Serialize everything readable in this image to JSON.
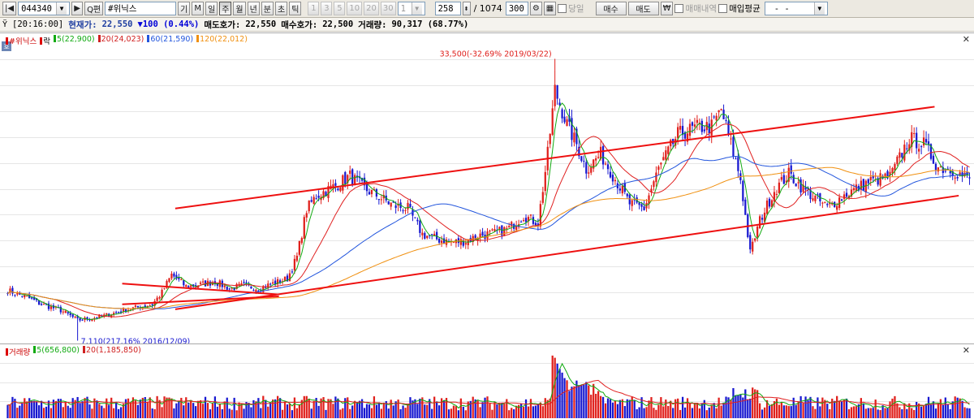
{
  "toolbar": {
    "stock_code": "044340",
    "stock_name": "#위닉스",
    "stock_name_btn": "기",
    "search_btn": "M",
    "prev_label": "◀",
    "next_label": "▶",
    "search_small": "Q편",
    "periods": [
      "일",
      "주",
      "월",
      "년",
      "분",
      "초",
      "틱"
    ],
    "active_period": "주",
    "minutes": [
      "1",
      "3",
      "5",
      "10",
      "20",
      "30"
    ],
    "minute_select": "1",
    "count_value": "258",
    "total_label": "/ 1074",
    "view_count": "300",
    "today_label": "당일",
    "buy_button": "매수",
    "sell_button": "매도",
    "trade_history": "매매내역",
    "avg_price": "매입평균",
    "last_select": "-  -"
  },
  "quote": {
    "time": "[20:16:00]",
    "current_label": "현재가:",
    "current_value": "22,550",
    "change": "▼100 (0.44%)",
    "ask_label": "매도호가:",
    "ask_value": "22,550",
    "bid_label": "매수호가:",
    "bid_value": "22,500",
    "volume_label": "거래량:",
    "volume_value": "90,317 (68.77%)"
  },
  "price_legend": {
    "name": "#위닉스",
    "type": "락",
    "ma5": "5(22,900)",
    "ma20": "20(24,023)",
    "ma60": "60(21,590)",
    "ma120": "120(22,012)"
  },
  "volume_legend": {
    "name": "거래량",
    "ma5": "5(656,800)",
    "ma20": "20(1,185,850)"
  },
  "annotations": {
    "high": "33,500(-32.69% 2019/03/22)",
    "low": "7,110(217.16% 2016/12/09)"
  },
  "colors": {
    "up": "#e0201c",
    "down": "#1818d0",
    "ma5": "#11aa11",
    "ma20": "#e02020",
    "ma60": "#2255dd",
    "ma120": "#f09010",
    "trendline": "#ee1010"
  },
  "chart_data": {
    "type": "candlestick",
    "ylim": [
      6000,
      36000
    ],
    "high": {
      "value": 33500,
      "date": "2019/03/22"
    },
    "low": {
      "value": 7110,
      "date": "2016/12/09"
    },
    "last_close": 22550,
    "anchors": [
      [
        0,
        11200
      ],
      [
        8,
        10500
      ],
      [
        14,
        9800
      ],
      [
        22,
        9200
      ],
      [
        29,
        8200
      ],
      [
        35,
        8400
      ],
      [
        41,
        8700
      ],
      [
        48,
        9200
      ],
      [
        54,
        9500
      ],
      [
        60,
        9800
      ],
      [
        64,
        11000
      ],
      [
        68,
        12800
      ],
      [
        74,
        11600
      ],
      [
        80,
        11800
      ],
      [
        86,
        12100
      ],
      [
        92,
        11400
      ],
      [
        98,
        11700
      ],
      [
        104,
        11400
      ],
      [
        110,
        11900
      ],
      [
        116,
        12400
      ],
      [
        120,
        14600
      ],
      [
        124,
        19400
      ],
      [
        128,
        20800
      ],
      [
        136,
        21800
      ],
      [
        142,
        22800
      ],
      [
        148,
        21500
      ],
      [
        154,
        20700
      ],
      [
        160,
        19800
      ],
      [
        166,
        19500
      ],
      [
        172,
        16900
      ],
      [
        178,
        16400
      ],
      [
        184,
        16100
      ],
      [
        190,
        16200
      ],
      [
        196,
        16800
      ],
      [
        202,
        17000
      ],
      [
        208,
        17500
      ],
      [
        214,
        18800
      ],
      [
        220,
        18000
      ],
      [
        224,
        25000
      ],
      [
        227,
        31500
      ],
      [
        232,
        28000
      ],
      [
        236,
        26000
      ],
      [
        240,
        23500
      ],
      [
        246,
        25000
      ],
      [
        252,
        22500
      ],
      [
        258,
        20000
      ],
      [
        264,
        19500
      ],
      [
        270,
        23500
      ],
      [
        278,
        27000
      ],
      [
        286,
        27700
      ],
      [
        292,
        27800
      ],
      [
        296,
        29500
      ],
      [
        304,
        22500
      ],
      [
        308,
        15000
      ],
      [
        312,
        18300
      ],
      [
        318,
        21300
      ],
      [
        324,
        23000
      ],
      [
        330,
        21500
      ],
      [
        340,
        19600
      ],
      [
        348,
        21000
      ],
      [
        358,
        22300
      ],
      [
        366,
        22700
      ],
      [
        374,
        26600
      ],
      [
        380,
        26000
      ],
      [
        386,
        23700
      ],
      [
        392,
        23400
      ],
      [
        398,
        22550
      ]
    ],
    "volume_peak_index": 226
  }
}
